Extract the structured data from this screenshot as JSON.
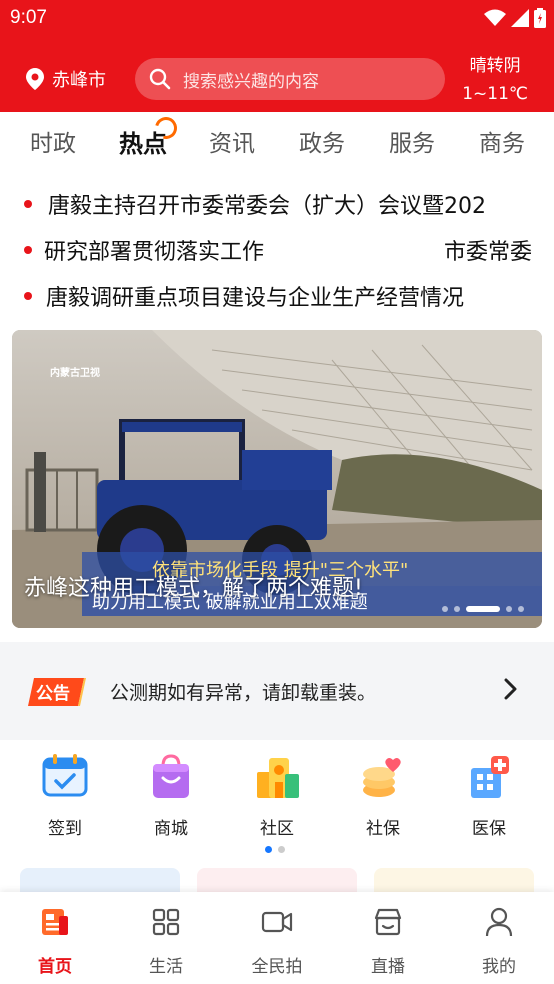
{
  "status_bar": {
    "time": "9:07"
  },
  "header": {
    "location": "赤峰市",
    "search_placeholder": "搜索感兴趣的内容",
    "weather_desc": "晴转阴",
    "weather_temp": "1~11℃"
  },
  "tabs": [
    {
      "label": "时政"
    },
    {
      "label": "热点"
    },
    {
      "label": "资讯"
    },
    {
      "label": "政务"
    },
    {
      "label": "服务"
    },
    {
      "label": "商务"
    }
  ],
  "news": [
    {
      "title": "唐毅主持召开市委常委会（扩大）会议暨202"
    },
    {
      "title_left": "研究部署贯彻落实工作",
      "title_right": "市委常委"
    },
    {
      "title": "唐毅调研重点项目建设与企业生产经营情况"
    }
  ],
  "banner": {
    "caption": "赤峰这种用工模式，解了两个难题!",
    "channel_logo": "内蒙古卫视",
    "image_subtitle": "依靠市场化手段 提升\"三个水平\"",
    "image_subtitle_2": "助力用工模式 破解就业用工双难题"
  },
  "notice": {
    "tag": "公告",
    "text": "公测期如有异常，请卸载重装。"
  },
  "services": [
    {
      "label": "签到",
      "icon": "calendar-check-icon"
    },
    {
      "label": "商城",
      "icon": "shopping-bag-icon"
    },
    {
      "label": "社区",
      "icon": "community-building-icon"
    },
    {
      "label": "社保",
      "icon": "social-security-icon"
    },
    {
      "label": "医保",
      "icon": "medical-insurance-icon"
    }
  ],
  "bottom_nav": [
    {
      "label": "首页",
      "icon": "news-home-icon"
    },
    {
      "label": "生活",
      "icon": "grid-icon"
    },
    {
      "label": "全民拍",
      "icon": "video-camera-icon"
    },
    {
      "label": "直播",
      "icon": "live-store-icon"
    },
    {
      "label": "我的",
      "icon": "user-icon"
    }
  ],
  "colors": {
    "brand_red": "#e8141a",
    "hot_orange": "#ff6a00",
    "page_dot_active": "#1677ff"
  }
}
